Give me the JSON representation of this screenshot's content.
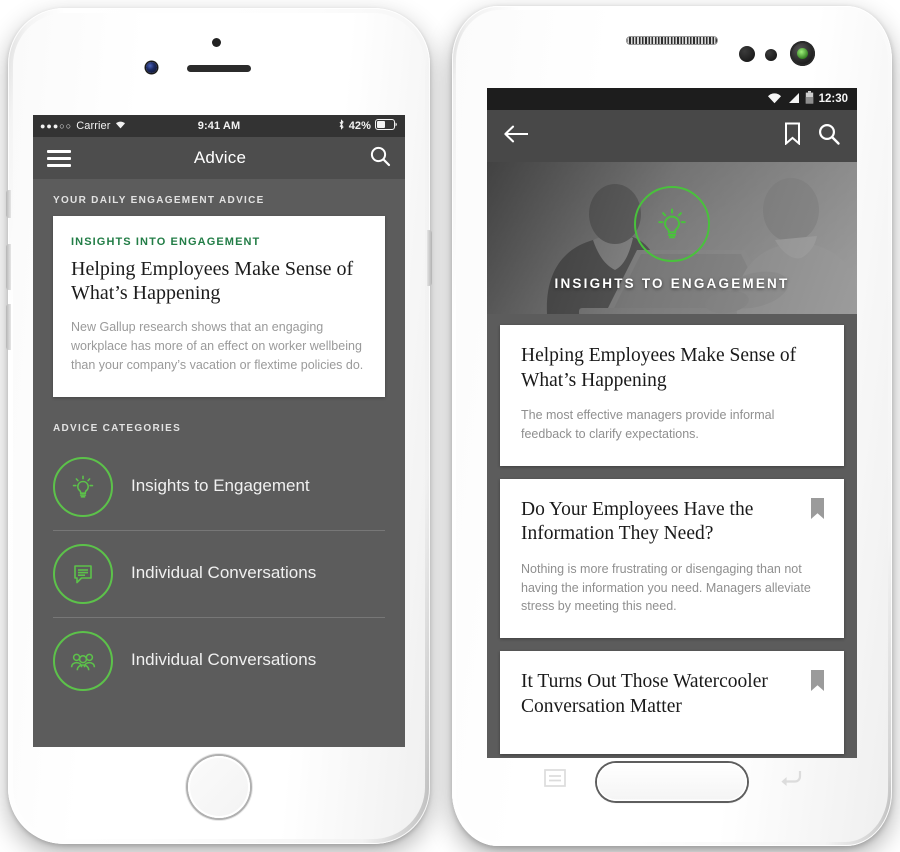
{
  "accent": {
    "green_bright": "#5cc24a",
    "green_dark": "#227d46",
    "screen_bg": "#5c5c5c",
    "appbar_bg": "#4d4d4d",
    "statusbar_bg": "#333333"
  },
  "iphone": {
    "status_bar": {
      "signal_dots": "●●●○○",
      "carrier": "Carrier",
      "wifi_icon": "wifi-icon",
      "time": "9:41 AM",
      "bluetooth_icon": "bluetooth-icon",
      "battery_text": "42%",
      "battery_icon": "battery-icon"
    },
    "nav_bar": {
      "menu_icon": "hamburger-menu-icon",
      "title": "Advice",
      "search_icon": "search-icon"
    },
    "daily": {
      "section_label": "YOUR DAILY ENGAGEMENT ADVICE",
      "card": {
        "kicker": "INSIGHTS INTO ENGAGEMENT",
        "title": "Helping Employees Make Sense of What’s Happening",
        "body": "New Gallup research shows that an engaging workplace has more of an effect on worker wellbeing than your company’s vacation or flextime policies do."
      }
    },
    "categories": {
      "section_label": "ADVICE CATEGORIES",
      "items": [
        {
          "icon": "lightbulb-icon",
          "label": "Insights to Engagement"
        },
        {
          "icon": "speech-bubble-icon",
          "label": "Individual Conversations"
        },
        {
          "icon": "people-group-icon",
          "label": "Individual Conversations"
        }
      ]
    },
    "hardware": {
      "home_button": "home-button",
      "camera": "front-camera",
      "speaker": "earpiece-speaker"
    }
  },
  "android": {
    "status_bar": {
      "wifi_icon": "wifi-icon",
      "signal_icon": "cellular-signal-icon",
      "battery_icon": "battery-icon",
      "time": "12:30"
    },
    "app_bar": {
      "back_icon": "back-arrow-icon",
      "bookmark_icon": "bookmark-icon",
      "search_icon": "search-icon"
    },
    "hero": {
      "icon": "lightbulb-icon",
      "label": "INSIGHTS TO ENGAGEMENT"
    },
    "cards": [
      {
        "title": "Helping Employees Make Sense of What’s Happening",
        "body": "The most effective managers provide informal feedback to clarify expectations.",
        "bookmarked": false
      },
      {
        "title": "Do Your Employees Have the Information They Need?",
        "body": "Nothing is more frustrating or disengaging than not having the information you need. Managers alleviate stress by meeting this need.",
        "bookmarked": true
      },
      {
        "title": "It Turns Out Those Watercooler Conversation Matter",
        "body": "",
        "bookmarked": true
      }
    ],
    "soft_keys": {
      "menu_icon": "menu-soft-key-icon",
      "home_icon": "home-hardware-button",
      "back_icon": "back-soft-key-icon"
    }
  }
}
